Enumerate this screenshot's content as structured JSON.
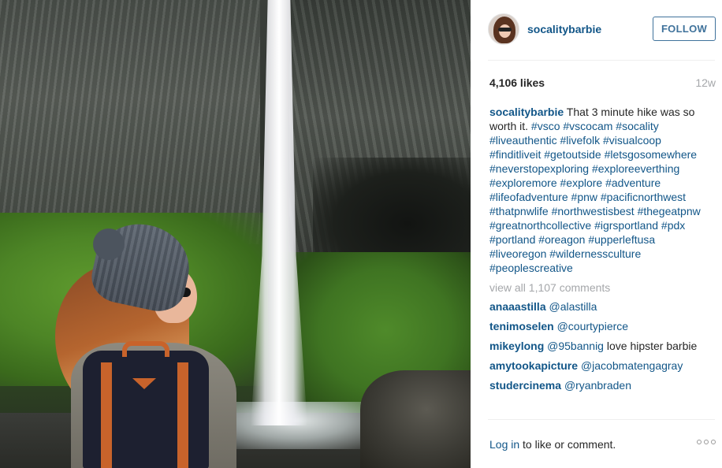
{
  "post": {
    "photo_alt": "",
    "user": {
      "username": "socalitybarbie",
      "follow_label": "FOLLOW"
    },
    "likes": "4,106 likes",
    "age": "12w",
    "caption": {
      "username": "socalitybarbie",
      "text": "That 3 minute hike was so worth it.",
      "hashtags": [
        "#vsco",
        "#vscocam",
        "#socality",
        "#liveauthentic",
        "#livefolk",
        "#visualcoop",
        "#finditliveit",
        "#getoutside",
        "#letsgosomewhere",
        "#neverstopexploring",
        "#exploreeverthing",
        "#exploremore",
        "#explore",
        "#adventure",
        "#lifeofadventure",
        "#pnw",
        "#pacificnorthwest",
        "#thatpnwlife",
        "#northwestisbest",
        "#thegeatpnw",
        "#greatnorthcollective",
        "#igrsportland",
        "#pdx",
        "#portland",
        "#oreagon",
        "#upperleftusa",
        "#liveoregon",
        "#wildernessculture",
        "#peoplescreative"
      ]
    },
    "view_all": "view all 1,107 comments",
    "comments": [
      {
        "user": "anaaastilla",
        "text": "@alastilla"
      },
      {
        "user": "tenimoselen",
        "text": "@courtypierce"
      },
      {
        "user": "mikeylong",
        "text": "@95bannig love hipster barbie"
      },
      {
        "user": "amytookapicture",
        "text": "@jacobmatengagray"
      },
      {
        "user": "studercinema",
        "text": "@ryanbraden"
      }
    ],
    "footer": {
      "login": "Log in",
      "rest": " to like or comment."
    }
  },
  "icons": {
    "more": "more-options-icon"
  }
}
